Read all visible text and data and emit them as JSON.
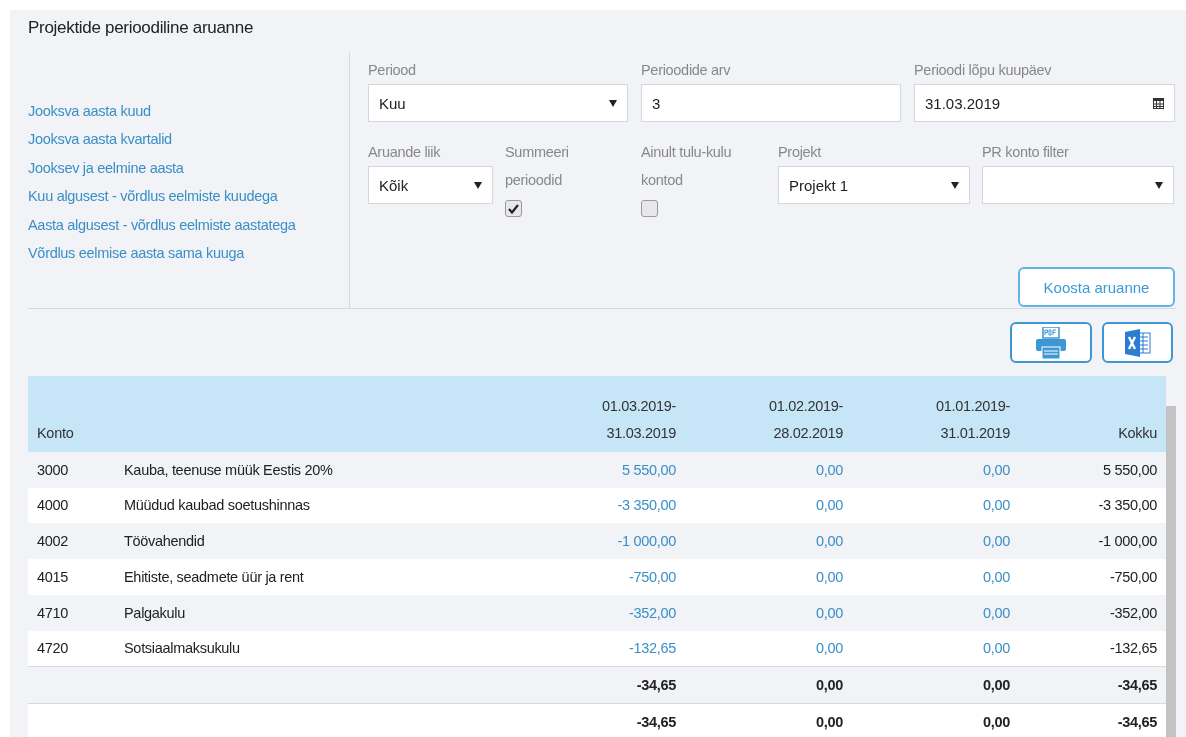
{
  "title": "Projektide perioodiline aruanne",
  "quick_links": [
    "Jooksva aasta kuud",
    "Jooksva aasta kvartalid",
    "Jooksev ja eelmine aasta",
    "Kuu algusest - võrdlus eelmiste kuudega",
    "Aasta algusest - võrdlus eelmiste aastatega",
    "Võrdlus eelmise aasta sama kuuga"
  ],
  "filters_row_1": [
    {
      "kind": "select",
      "label": "Periood",
      "value": "Kuu"
    },
    {
      "kind": "input",
      "label": "Perioodide arv",
      "value": "3"
    },
    {
      "kind": "date",
      "label": "Perioodi lõpu kuupäev",
      "value": "31.03.2019"
    }
  ],
  "filters_row_2": [
    {
      "kind": "select",
      "label": "Aruande liik",
      "value": "Kõik"
    },
    {
      "kind": "checkbox",
      "label": "Summeeri perioodid",
      "checked": true
    },
    {
      "kind": "checkbox",
      "label": "Ainult tulu-kulu kontod",
      "checked": false
    },
    {
      "kind": "select",
      "label": "Projekt",
      "value": "Projekt 1"
    },
    {
      "kind": "select",
      "label": "PR konto filter"
    }
  ],
  "generate_button": "Koosta aruanne",
  "export_buttons": [
    {
      "kind": "pdf"
    },
    {
      "kind": "excel"
    }
  ],
  "table": {
    "header_rows": [
      [
        "",
        "",
        "01.03.2019-",
        "01.02.2019-",
        "01.01.2019-",
        ""
      ],
      [
        "Konto",
        "",
        "31.03.2019",
        "28.02.2019",
        "31.01.2019",
        "Kokku"
      ]
    ],
    "rows": [
      {
        "kind": "account",
        "cells": [
          "3000",
          "Kauba, teenuse müük Eestis 20%",
          "5 550,00",
          "0,00",
          "0,00",
          "5 550,00"
        ]
      },
      {
        "kind": "account",
        "cells": [
          "4000",
          "Müüdud kaubad soetushinnas",
          "-3 350,00",
          "0,00",
          "0,00",
          "-3 350,00"
        ]
      },
      {
        "kind": "account",
        "cells": [
          "4002",
          "Töövahendid",
          "-1 000,00",
          "0,00",
          "0,00",
          "-1 000,00"
        ]
      },
      {
        "kind": "account",
        "cells": [
          "4015",
          "Ehitiste, seadmete üür ja rent",
          "-750,00",
          "0,00",
          "0,00",
          "-750,00"
        ]
      },
      {
        "kind": "account",
        "cells": [
          "4710",
          "Palgakulu",
          "-352,00",
          "0,00",
          "0,00",
          "-352,00"
        ]
      },
      {
        "kind": "account",
        "cells": [
          "4720",
          "Sotsiaalmaksukulu",
          "-132,65",
          "0,00",
          "0,00",
          "-132,65"
        ]
      },
      {
        "kind": "total",
        "cells": [
          "",
          "",
          "-34,65",
          "0,00",
          "0,00",
          "-34,65"
        ]
      },
      {
        "kind": "total",
        "cells": [
          "",
          "",
          "-34,65",
          "0,00",
          "0,00",
          "-34,65"
        ]
      }
    ]
  }
}
